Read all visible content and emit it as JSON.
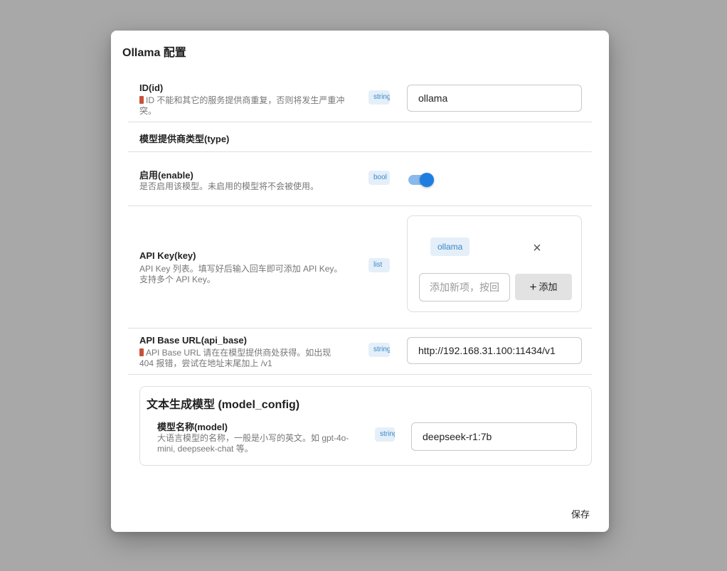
{
  "dialog": {
    "title": "Ollama 配置",
    "save_label": "保存"
  },
  "fields": {
    "id": {
      "label": "ID(id)",
      "hint": "ID 不能和其它的服务提供商重复，否则将发生严重冲突。",
      "type": "string",
      "value": "ollama"
    },
    "type": {
      "label": "模型提供商类型(type)"
    },
    "enable": {
      "label": "启用(enable)",
      "hint": "是否启用该模型。未启用的模型将不会被使用。",
      "type": "bool",
      "value": true
    },
    "key": {
      "label": "API Key(key)",
      "hint": "API Key 列表。填写好后输入回车即可添加 API Key。支持多个 API Key。",
      "type": "list",
      "items": [
        "ollama"
      ],
      "new_item_placeholder": "添加新项，按回车确认",
      "add_label": "添加"
    },
    "api_base": {
      "label": "API Base URL(api_base)",
      "hint": "API Base URL 请在在模型提供商处获得。如出现 404 报错，尝试在地址末尾加上 /v1",
      "type": "string",
      "value": "http://192.168.31.100:11434/v1"
    }
  },
  "model_config": {
    "title": "文本生成模型 (model_config)",
    "model": {
      "label": "模型名称(model)",
      "hint": "大语言模型的名称，一般是小写的英文。如 gpt-4o-mini, deepseek-chat 等。",
      "type": "string",
      "value": "deepseek-r1:7b"
    }
  },
  "colors": {
    "backdrop": "#a8a8a8",
    "accent": "#1e7ee0",
    "badge_bg": "#e4eff9",
    "badge_text": "#3a86c8",
    "warning": "#c9513b"
  }
}
